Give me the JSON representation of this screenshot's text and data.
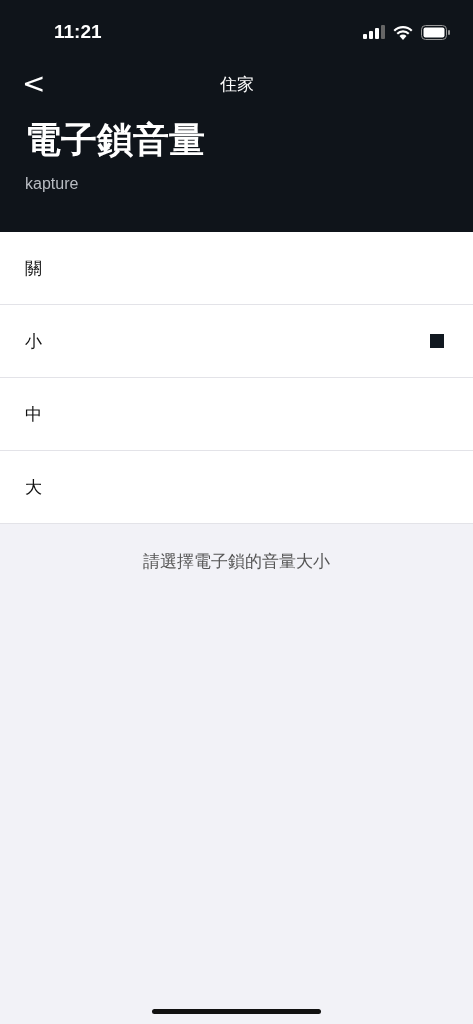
{
  "status_bar": {
    "time": "11:21"
  },
  "nav": {
    "back": "<",
    "title": "住家"
  },
  "header": {
    "title": "電子鎖音量",
    "subtitle": "kapture"
  },
  "options": [
    {
      "label": "關",
      "selected": false
    },
    {
      "label": "小",
      "selected": true
    },
    {
      "label": "中",
      "selected": false
    },
    {
      "label": "大",
      "selected": false
    }
  ],
  "footer_note": "請選擇電子鎖的音量大小"
}
